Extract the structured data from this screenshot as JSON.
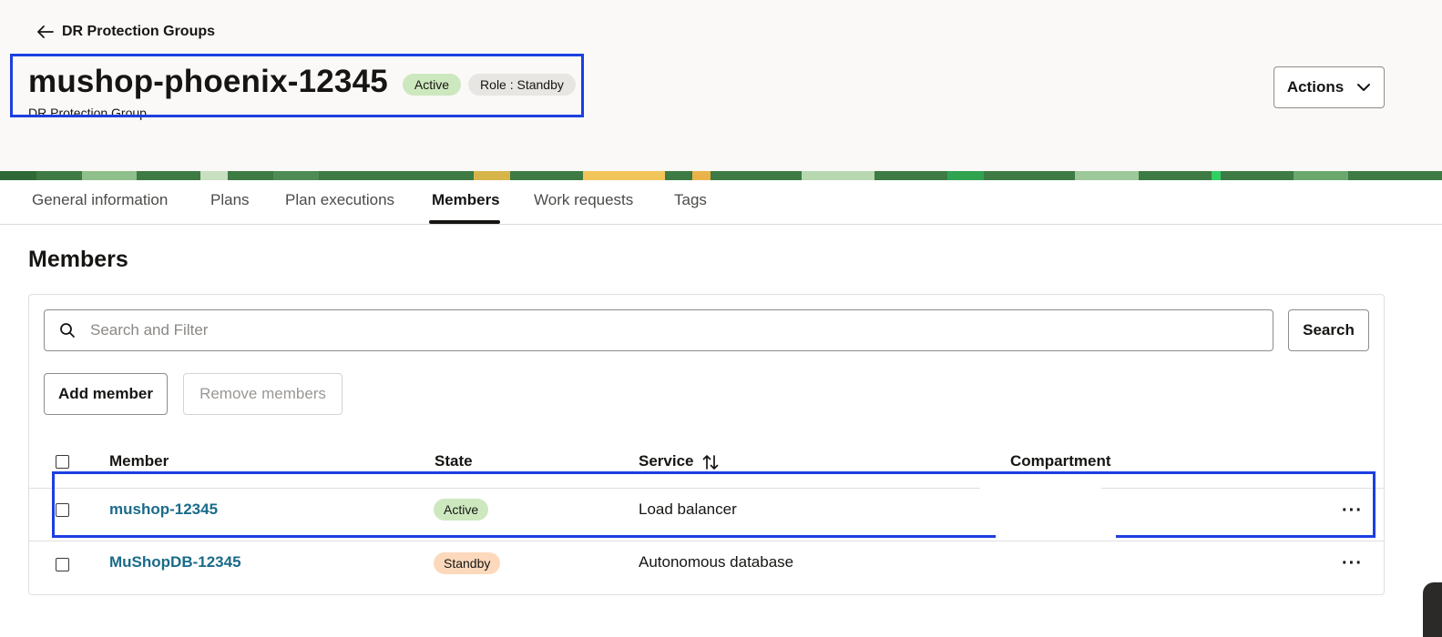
{
  "header": {
    "back_label": "DR Protection Groups",
    "title": "mushop-phoenix-12345",
    "subtitle": "DR Protection Group",
    "badges": {
      "state": "Active",
      "role": "Role : Standby"
    },
    "actions_label": "Actions"
  },
  "tabs": [
    {
      "label": "General information",
      "active": false
    },
    {
      "label": "Plans",
      "active": false
    },
    {
      "label": "Plan executions",
      "active": false
    },
    {
      "label": "Members",
      "active": true
    },
    {
      "label": "Work requests",
      "active": false
    },
    {
      "label": "Tags",
      "active": false
    }
  ],
  "section_title": "Members",
  "search": {
    "placeholder": "Search and Filter",
    "button_label": "Search"
  },
  "toolbar": {
    "add_label": "Add member",
    "remove_label": "Remove members"
  },
  "table": {
    "columns": [
      "Member",
      "State",
      "Service",
      "Compartment"
    ],
    "rows": [
      {
        "member": "mushop-12345",
        "state": "Active",
        "service": "Load balancer",
        "compartment": ""
      },
      {
        "member": "MuShopDB-12345",
        "state": "Standby",
        "service": "Autonomous database",
        "compartment": ""
      }
    ],
    "row_menu": "···"
  },
  "colors": {
    "accent_link": "#1a6b8a",
    "highlight_box": "#1c3fe0",
    "active_badge": "#cde8bf",
    "standby_badge": "#fcd9bc"
  }
}
